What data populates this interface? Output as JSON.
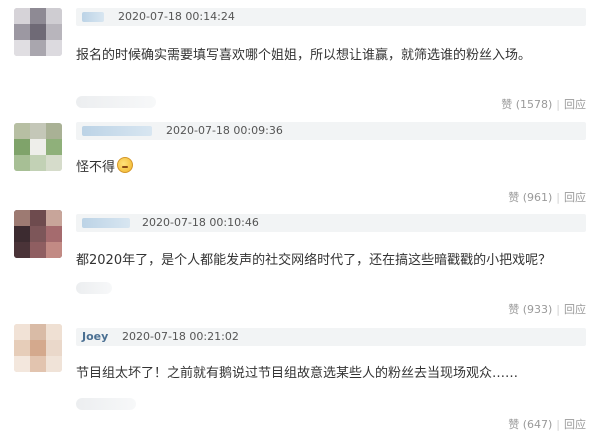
{
  "comments": [
    {
      "username": "",
      "timestamp": "2020-07-18 00:14:24",
      "text": "报名的时候确实需要填写喜欢哪个姐姐，所以想让谁赢，就筛选谁的粉丝入场。",
      "like_label": "赞",
      "like_count": "(1578)",
      "reply_label": "回应"
    },
    {
      "username": "",
      "timestamp": "2020-07-18 00:09:36",
      "text": "怪不得",
      "emoji": "thinking-emoji",
      "like_label": "赞",
      "like_count": "(961)",
      "reply_label": "回应"
    },
    {
      "username": "",
      "timestamp": "2020-07-18 00:10:46",
      "text": "都2020年了，是个人都能发声的社交网络时代了，还在搞这些暗戳戳的小把戏呢？",
      "like_label": "赞",
      "like_count": "(933)",
      "reply_label": "回应"
    },
    {
      "username": "Joey",
      "timestamp": "2020-07-18 00:21:02",
      "text": "节目组太坏了！之前就有鹅说过节目组故意选某些人的粉丝去当现场观众……",
      "like_label": "赞",
      "like_count": "(647)",
      "reply_label": "回应"
    }
  ]
}
